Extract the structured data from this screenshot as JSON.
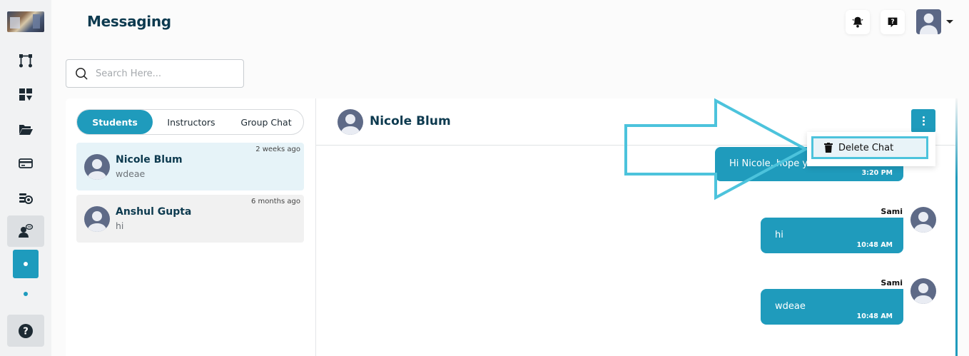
{
  "app": {
    "title": "Messaging"
  },
  "search": {
    "placeholder": "Search Here..."
  },
  "tabs": [
    {
      "label": "Students",
      "active": true
    },
    {
      "label": "Instructors",
      "active": false
    },
    {
      "label": "Group Chat",
      "active": false
    }
  ],
  "conversations": [
    {
      "name": "Nicole Blum",
      "preview": "wdeae",
      "time": "2 weeks ago",
      "selected": true
    },
    {
      "name": "Anshul Gupta",
      "preview": "hi",
      "time": "6 months ago",
      "selected": false
    }
  ],
  "chat": {
    "contact_name": "Nicole Blum",
    "messages": [
      {
        "text": "Hi Nicole, hope y",
        "time": "3:20 PM",
        "sender": ""
      },
      {
        "text": "hi",
        "time": "10:48 AM",
        "sender": "Sami"
      },
      {
        "text": "wdeae",
        "time": "10:48 AM",
        "sender": "Sami"
      }
    ]
  },
  "menu": {
    "delete_label": "Delete Chat"
  },
  "icons": {
    "rail": [
      "workflow-icon",
      "dashboard-icon",
      "folder-open-icon",
      "credit-card-icon",
      "coins-icon",
      "user-chat-icon",
      "help-icon"
    ],
    "header": [
      "bell-icon",
      "question-icon",
      "avatar",
      "chevron-down-icon"
    ]
  },
  "colors": {
    "accent": "#1f9bbc",
    "arrow": "#4cc3dc",
    "title": "#0d3a4f"
  }
}
